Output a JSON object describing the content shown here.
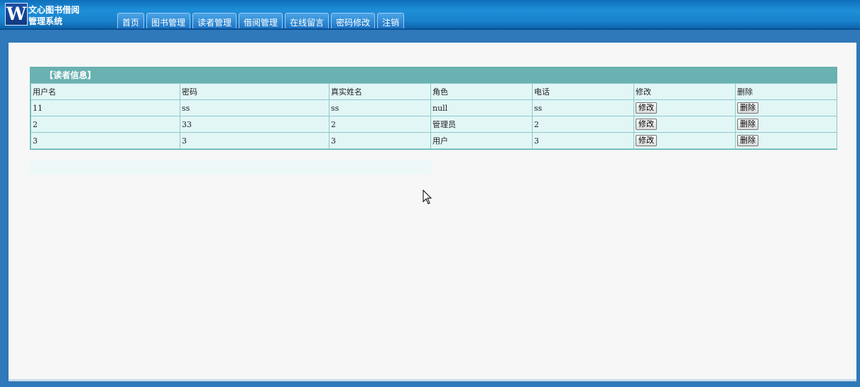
{
  "app": {
    "logo_letter": "W",
    "logo_line1": "文心图书借阅",
    "logo_line2": "管理系统"
  },
  "nav": [
    {
      "label": "首页"
    },
    {
      "label": "图书管理"
    },
    {
      "label": "读者管理"
    },
    {
      "label": "借阅管理"
    },
    {
      "label": "在线留言"
    },
    {
      "label": "密码修改"
    },
    {
      "label": "注销"
    }
  ],
  "reader_table": {
    "title": "【读者信息】",
    "headers": [
      "用户名",
      "密码",
      "真实姓名",
      "角色",
      "电话",
      "修改",
      "删除"
    ],
    "rows": [
      {
        "username": "11",
        "password": "ss",
        "realname": "ss",
        "role": "null",
        "phone": "ss"
      },
      {
        "username": "2",
        "password": "33",
        "realname": "2",
        "role": "管理员",
        "phone": "2"
      },
      {
        "username": "3",
        "password": "3",
        "realname": "3",
        "role": "用户",
        "phone": "3"
      }
    ],
    "edit_label": "修改",
    "delete_label": "删除"
  },
  "colors": {
    "header": "#1a82cc",
    "panel": "#f7f7f7",
    "table_title": "#6ab1b1",
    "table_cell": "#e2f6f6"
  }
}
